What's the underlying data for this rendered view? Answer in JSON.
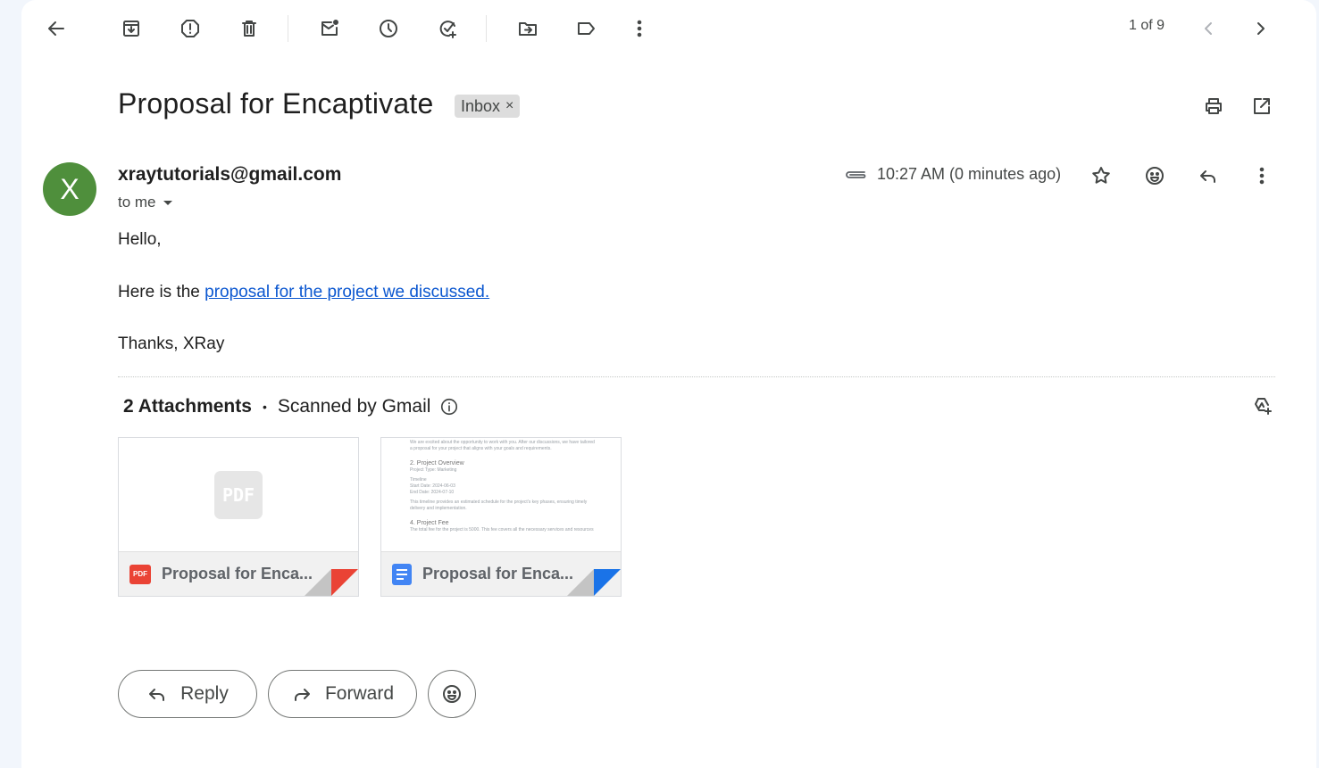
{
  "toolbar": {
    "back": "back-icon",
    "actions": [
      "archive",
      "report-spam",
      "delete",
      "mark-as-unread",
      "snooze",
      "add-to-tasks",
      "move-to",
      "labels",
      "more"
    ],
    "pager": "1 of 9"
  },
  "subject": {
    "title": "Proposal for Encaptivate",
    "label": "Inbox",
    "label_remove": "×"
  },
  "message": {
    "avatar_letter": "X",
    "avatar_color": "#4f8f3c",
    "sender": "xraytutorials@gmail.com",
    "recipient": "to me",
    "time": "10:27 AM (0 minutes ago)",
    "greeting": "Hello,",
    "line_prefix": "Here is the ",
    "link_text": "proposal for the project we discussed.",
    "signoff": "Thanks, XRay"
  },
  "attachments": {
    "count_label": "2 Attachments",
    "separator": "•",
    "scanned": "Scanned by Gmail",
    "items": [
      {
        "name": "Proposal for Enca...",
        "type": "PDF",
        "thumb_label": "PDF",
        "accent": "#ea4335"
      },
      {
        "name": "Proposal for Enca...",
        "type": "Google Doc",
        "accent": "#1a73e8",
        "preview": {
          "intro": "We are excited about the opportunity to work with you. After our discussions, we have tailored a proposal for your project that aligns with your goals and requirements.",
          "h2": "2. Project Overview",
          "type": "Project Type: Marketing",
          "timeline": "Timeline",
          "start": "Start Date: 2024-06-03",
          "end": "End Date: 2024-07-10",
          "note": "This timeline provides an estimated schedule for the project's key phases, ensuring timely delivery and implementation.",
          "h4": "4. Project Fee",
          "fee": "The total fee for the project is 5000. This fee covers all the necessary services and resources"
        }
      }
    ]
  },
  "actions": {
    "reply": "Reply",
    "forward": "Forward"
  }
}
